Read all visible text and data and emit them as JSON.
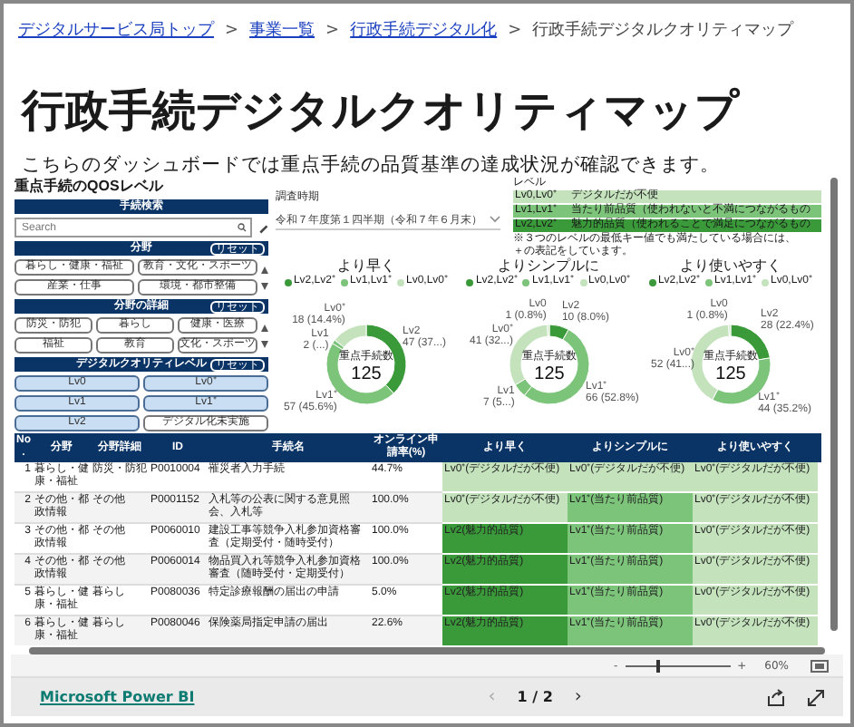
{
  "breadcrumb": [
    {
      "label": "デジタルサービス局トップ",
      "link": true
    },
    {
      "label": "事業一覧",
      "link": true
    },
    {
      "label": "行政手続デジタル化",
      "link": true
    },
    {
      "label": "行政手続デジタルクオリティマップ",
      "link": false
    }
  ],
  "breadcrumb_separator": ">",
  "title": "行政手続デジタルクオリティマップ",
  "description": "こちらのダッシュボードでは重点手続の品質基準の達成状況が確認できます。",
  "report": {
    "panel_title": "重点手続のQOSレベル",
    "search": {
      "header": "手続検索",
      "placeholder": "Search"
    },
    "filters": [
      {
        "header": "分野",
        "reset": "リセット",
        "chips": [
          {
            "label": "暮らし・健康・福祉",
            "selected": false
          },
          {
            "label": "教育・文化・スポーツ",
            "selected": false
          },
          {
            "label": "産業・仕事",
            "selected": false
          },
          {
            "label": "環境・都市整備",
            "selected": false
          }
        ],
        "scroll": true
      },
      {
        "header": "分野の詳細",
        "reset": "リセット",
        "chips": [
          {
            "label": "防災・防犯",
            "selected": false
          },
          {
            "label": "暮らし",
            "selected": false
          },
          {
            "label": "健康・医療",
            "selected": false
          },
          {
            "label": "福祉",
            "selected": false
          },
          {
            "label": "教育",
            "selected": false
          },
          {
            "label": "文化・スポーツ",
            "selected": false
          }
        ],
        "scroll": true
      },
      {
        "header": "デジタルクオリティレベル",
        "reset": "リセット",
        "chips": [
          {
            "label": "Lv0",
            "selected": true
          },
          {
            "label": "Lv0⁺",
            "selected": true
          },
          {
            "label": "Lv1",
            "selected": true
          },
          {
            "label": "Lv1⁺",
            "selected": true
          },
          {
            "label": "Lv2",
            "selected": true
          },
          {
            "label": "デジタル化未実施",
            "selected": false
          }
        ],
        "scroll": false
      }
    ],
    "period": {
      "label": "調査時期",
      "value": "令和７年度第１四半期（令和７年６月末）"
    },
    "level_legend": {
      "title": "レベル",
      "rows": [
        {
          "code": "Lv0,Lv0⁺",
          "text": "デジタルだが不便",
          "color": "#c4e3bd"
        },
        {
          "code": "Lv1,Lv1⁺",
          "text": "当たり前品質（使われないと不満につながるもの",
          "color": "#7dc47b"
        },
        {
          "code": "Lv2,Lv2⁺",
          "text": "魅力的品質（使われることで満足につながるもの",
          "color": "#3a9a3a"
        }
      ],
      "notes": [
        "※３つのレベルの最低キー値でも満たしている場合には、",
        "＋の表記をしています。"
      ]
    },
    "charts": [
      {
        "title": "より早く",
        "legend": [
          {
            "label": "Lv2,Lv2⁺",
            "color": "#3a9a3a"
          },
          {
            "label": "Lv1,Lv1⁺",
            "color": "#7dc47b"
          },
          {
            "label": "Lv0,Lv0⁺",
            "color": "#c4e3bd"
          }
        ],
        "center_label": "重点手続数",
        "center_value": "125",
        "chart_data": {
          "type": "donut",
          "categories": [
            "Lv2",
            "Lv1⁺",
            "Lv1",
            "Lv0⁺"
          ],
          "values": [
            47,
            57,
            2,
            18
          ],
          "colors": [
            "#3a9a3a",
            "#7dc47b",
            "#7dc47b",
            "#c4e3bd"
          ],
          "value_labels": [
            "47 (37...)",
            "57 (45.6%)",
            "2 (...)",
            "18 (14.4%)"
          ]
        }
      },
      {
        "title": "よりシンプルに",
        "legend": [
          {
            "label": "Lv2,Lv2⁺",
            "color": "#3a9a3a"
          },
          {
            "label": "Lv1,Lv1⁺",
            "color": "#7dc47b"
          },
          {
            "label": "Lv0,Lv0⁺",
            "color": "#c4e3bd"
          }
        ],
        "center_label": "重点手続数",
        "center_value": "125",
        "chart_data": {
          "type": "donut",
          "categories": [
            "Lv2",
            "Lv1⁺",
            "Lv1",
            "Lv0⁺",
            "Lv0"
          ],
          "values": [
            10,
            66,
            7,
            41,
            1
          ],
          "colors": [
            "#3a9a3a",
            "#7dc47b",
            "#7dc47b",
            "#c4e3bd",
            "#c4e3bd"
          ],
          "value_labels": [
            "10 (8.0%)",
            "66 (52.8%)",
            "7 (5...)",
            "41 (32...)",
            "1 (0.8%)"
          ]
        }
      },
      {
        "title": "より使いやすく",
        "legend": [
          {
            "label": "Lv2,Lv2⁺",
            "color": "#3a9a3a"
          },
          {
            "label": "Lv1,Lv1⁺",
            "color": "#7dc47b"
          },
          {
            "label": "Lv0,Lv0⁺",
            "color": "#c4e3bd"
          }
        ],
        "center_label": "重点手続数",
        "center_value": "125",
        "chart_data": {
          "type": "donut",
          "categories": [
            "Lv2",
            "Lv1⁺",
            "Lv0⁺",
            "Lv0"
          ],
          "values": [
            28,
            44,
            52,
            1
          ],
          "colors": [
            "#3a9a3a",
            "#7dc47b",
            "#c4e3bd",
            "#c4e3bd"
          ],
          "value_labels": [
            "28 (22.4%)",
            "44 (35.2%)",
            "52 (41...)",
            "1 (0.8%)"
          ]
        }
      }
    ],
    "table": {
      "columns": [
        "No.",
        "分野",
        "分野詳細",
        "ID",
        "手続名",
        "オンライン申請率(%)",
        "より早く",
        "よりシンプルに",
        "より使いやすく"
      ],
      "rows": [
        {
          "no": "1",
          "field": "暮らし・健康・福祉",
          "detail": "防災・防犯",
          "id": "P0010004",
          "name": "罹災者入力手続",
          "rate": "44.7%",
          "quality": [
            {
              "text": "Lv0⁺(デジタルだが不便)",
              "color": "#c4e3bd"
            },
            {
              "text": "Lv0⁺(デジタルだが不便)",
              "color": "#c4e3bd"
            },
            {
              "text": "Lv0⁺(デジタルだが不便)",
              "color": "#c4e3bd"
            }
          ]
        },
        {
          "no": "2",
          "field": "その他・都政情報",
          "detail": "その他",
          "id": "P0001152",
          "name": "入札等の公表に関する意見照会、入札等",
          "rate": "100.0%",
          "quality": [
            {
              "text": "Lv0⁺(デジタルだが不便)",
              "color": "#c4e3bd"
            },
            {
              "text": "Lv1⁺(当たり前品質)",
              "color": "#7dc47b"
            },
            {
              "text": "Lv0⁺(デジタルだが不便)",
              "color": "#c4e3bd"
            }
          ]
        },
        {
          "no": "3",
          "field": "その他・都政情報",
          "detail": "その他",
          "id": "P0060010",
          "name": "建設工事等競争入札参加資格審査（定期受付・随時受付）",
          "rate": "100.0%",
          "quality": [
            {
              "text": "Lv2(魅力的品質)",
              "color": "#3a9a3a"
            },
            {
              "text": "Lv1⁺(当たり前品質)",
              "color": "#7dc47b"
            },
            {
              "text": "Lv0⁺(デジタルだが不便)",
              "color": "#c4e3bd"
            }
          ]
        },
        {
          "no": "4",
          "field": "その他・都政情報",
          "detail": "その他",
          "id": "P0060014",
          "name": "物品買入れ等競争入札参加資格審査（随時受付・定期受付）",
          "rate": "100.0%",
          "quality": [
            {
              "text": "Lv2(魅力的品質)",
              "color": "#3a9a3a"
            },
            {
              "text": "Lv1⁺(当たり前品質)",
              "color": "#7dc47b"
            },
            {
              "text": "Lv0⁺(デジタルだが不便)",
              "color": "#c4e3bd"
            }
          ]
        },
        {
          "no": "5",
          "field": "暮らし・健康・福祉",
          "detail": "暮らし",
          "id": "P0080036",
          "name": "特定診療報酬の届出の申請",
          "rate": "5.0%",
          "quality": [
            {
              "text": "Lv2(魅力的品質)",
              "color": "#3a9a3a"
            },
            {
              "text": "Lv1⁺(当たり前品質)",
              "color": "#7dc47b"
            },
            {
              "text": "Lv0⁺(デジタルだが不便)",
              "color": "#c4e3bd"
            }
          ]
        },
        {
          "no": "6",
          "field": "暮らし・健康・福祉",
          "detail": "暮らし",
          "id": "P0080046",
          "name": "保険薬局指定申請の届出",
          "rate": "22.6%",
          "quality": [
            {
              "text": "Lv2(魅力的品質)",
              "color": "#3a9a3a"
            },
            {
              "text": "Lv1⁺(当たり前品質)",
              "color": "#7dc47b"
            },
            {
              "text": "Lv0⁺(デジタルだが不便)",
              "color": "#c4e3bd"
            }
          ]
        }
      ]
    }
  },
  "zoom": {
    "minus": "-",
    "plus": "+",
    "level": 0.3,
    "reading": "60%"
  },
  "footer": {
    "brand": "Microsoft Power BI",
    "prev": "‹",
    "page": "1 / 2",
    "next": "›"
  }
}
